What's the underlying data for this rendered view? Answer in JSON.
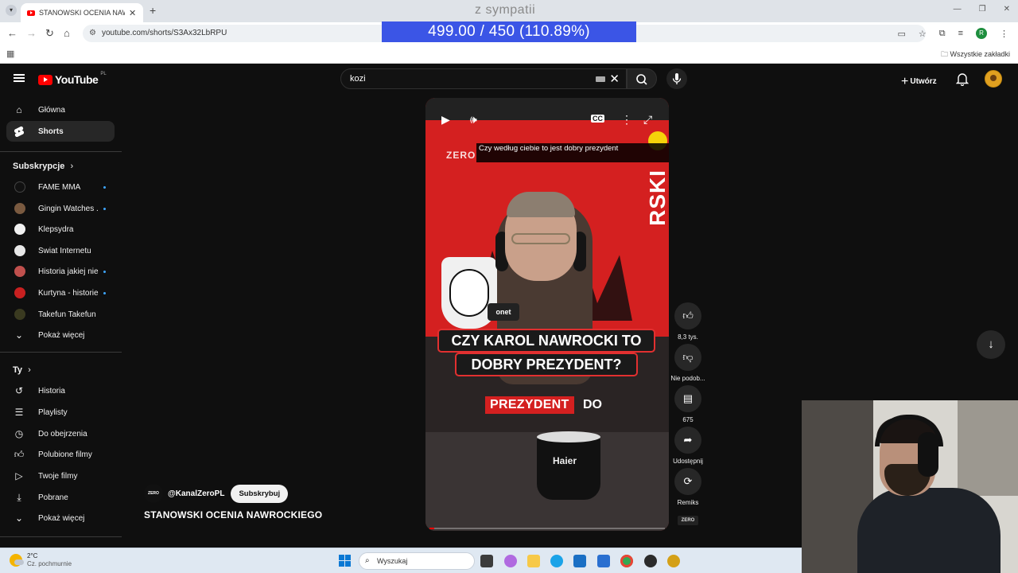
{
  "browser": {
    "tab_title": "STANOWSKI OCENIA NAWRO",
    "new_tab": "+",
    "url": "youtube.com/shorts/S3Ax32LbRPU",
    "all_bookmarks": "Wszystkie zakładki",
    "profile_initial": "R"
  },
  "stream_overlay": {
    "top_text": "z sympatii",
    "counter": "499.00 / 450 (110.89%)"
  },
  "youtube": {
    "logo": "YouTube",
    "country": "PL",
    "search_query": "kozi",
    "create_label": "Utwórz"
  },
  "sidebar": {
    "main": [
      {
        "label": "Główna",
        "icon": "home-icon"
      },
      {
        "label": "Shorts",
        "icon": "shorts-icon",
        "active": true
      }
    ],
    "subs_heading": "Subskrypcje",
    "subscriptions": [
      {
        "label": "FAME MMA",
        "color": "#111111",
        "dot": true
      },
      {
        "label": "Gingin Watches ...",
        "color": "#7a5a40",
        "dot": true
      },
      {
        "label": "Klepsydra",
        "color": "#f1f1f1",
        "dot": false
      },
      {
        "label": "Świat Internetu",
        "color": "#e8e8e8",
        "dot": false
      },
      {
        "label": "Historia jakiej nie...",
        "color": "#c0504d",
        "dot": true
      },
      {
        "label": "Kurtyna - historie...",
        "color": "#c82020",
        "dot": true
      },
      {
        "label": "Takefun Takefun",
        "color": "#3a3a20",
        "dot": false
      }
    ],
    "subs_more": "Pokaż więcej",
    "you_heading": "Ty",
    "you_items": [
      {
        "label": "Historia",
        "icon": "history-icon"
      },
      {
        "label": "Playlisty",
        "icon": "playlist-icon"
      },
      {
        "label": "Do obejrzenia",
        "icon": "watch-later-icon"
      },
      {
        "label": "Polubione filmy",
        "icon": "thumbs-up-icon"
      },
      {
        "label": "Twoje filmy",
        "icon": "your-videos-icon"
      },
      {
        "label": "Pobrane",
        "icon": "download-icon"
      }
    ],
    "you_more": "Pokaż więcej"
  },
  "short": {
    "caption": "Czy według ciebie to jest dobry prezydent",
    "brand_overlay": "ZERO",
    "vertical_text": "RSKI",
    "headline_1": "CZY KAROL NAWROCKI TO",
    "headline_2": "DOBRY PREZYDENT?",
    "subtitle_highlight": "PREZYDENT",
    "subtitle_rest": "DO",
    "mic_brand": "onet",
    "mug_brand": "Haier",
    "progress": 0.02,
    "channel_handle": "@KanalZeroPL",
    "channel_avatar_text": "ZERO",
    "subscribe": "Subskrybuj",
    "title": "STANOWSKI OCENIA NAWROCKIEGO"
  },
  "actions": [
    {
      "label": "8,3 tys.",
      "icon": "thumbs-up-icon"
    },
    {
      "label": "Nie podob...",
      "icon": "thumbs-down-icon"
    },
    {
      "label": "675",
      "icon": "comments-icon"
    },
    {
      "label": "Udostępnij",
      "icon": "share-icon"
    },
    {
      "label": "Remiks",
      "icon": "remix-icon"
    }
  ],
  "taskbar": {
    "temperature": "2°C",
    "weather": "Cz. pochmurnie",
    "search_placeholder": "Wyszukaj",
    "apps": [
      {
        "name": "task-view",
        "color": "#3c3c3c"
      },
      {
        "name": "copilot",
        "color": "#b06ae0"
      },
      {
        "name": "file-explorer",
        "color": "#f7c948"
      },
      {
        "name": "edge",
        "color": "#1aa3e8"
      },
      {
        "name": "outlook",
        "color": "#1a6fc4"
      },
      {
        "name": "store",
        "color": "#2a6fd0"
      },
      {
        "name": "chrome",
        "color": "#34a853"
      },
      {
        "name": "obs",
        "color": "#2b2b2b"
      },
      {
        "name": "app-yellow",
        "color": "#d4a017"
      }
    ]
  }
}
